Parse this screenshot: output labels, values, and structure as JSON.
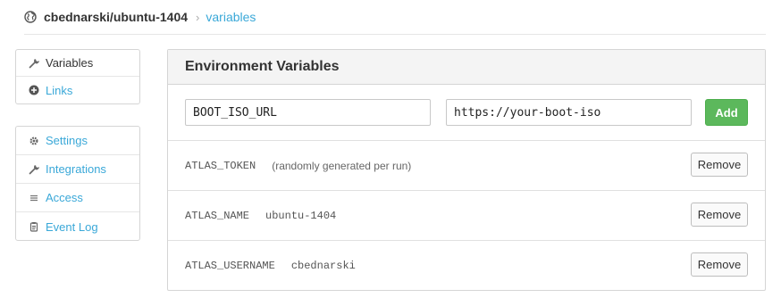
{
  "breadcrumb": {
    "globe_icon": "globe-icon",
    "repo": "cbednarski/ubuntu-1404",
    "separator": "›",
    "current": "variables"
  },
  "sidenav_top": [
    {
      "label": "Variables",
      "icon": "wrench-icon",
      "active": true
    },
    {
      "label": "Links",
      "icon": "plus-circle-icon",
      "active": false
    }
  ],
  "sidenav_bottom": [
    {
      "label": "Settings",
      "icon": "gear-icon"
    },
    {
      "label": "Integrations",
      "icon": "wrench-icon"
    },
    {
      "label": "Access",
      "icon": "menu-lines-icon"
    },
    {
      "label": "Event Log",
      "icon": "clipboard-icon"
    }
  ],
  "panel": {
    "title": "Environment Variables",
    "form": {
      "key_value": "BOOT_ISO_URL",
      "value_value": "https://your-boot-iso",
      "add_label": "Add"
    },
    "variables": [
      {
        "key": "ATLAS_TOKEN",
        "value": "",
        "note": "(randomly generated per run)",
        "remove_label": "Remove"
      },
      {
        "key": "ATLAS_NAME",
        "value": "ubuntu-1404",
        "note": "",
        "remove_label": "Remove"
      },
      {
        "key": "ATLAS_USERNAME",
        "value": "cbednarski",
        "note": "",
        "remove_label": "Remove"
      }
    ]
  },
  "colors": {
    "link": "#3aa8d8",
    "add_button": "#5cb85c",
    "header_bg": "#f4f4f4"
  }
}
